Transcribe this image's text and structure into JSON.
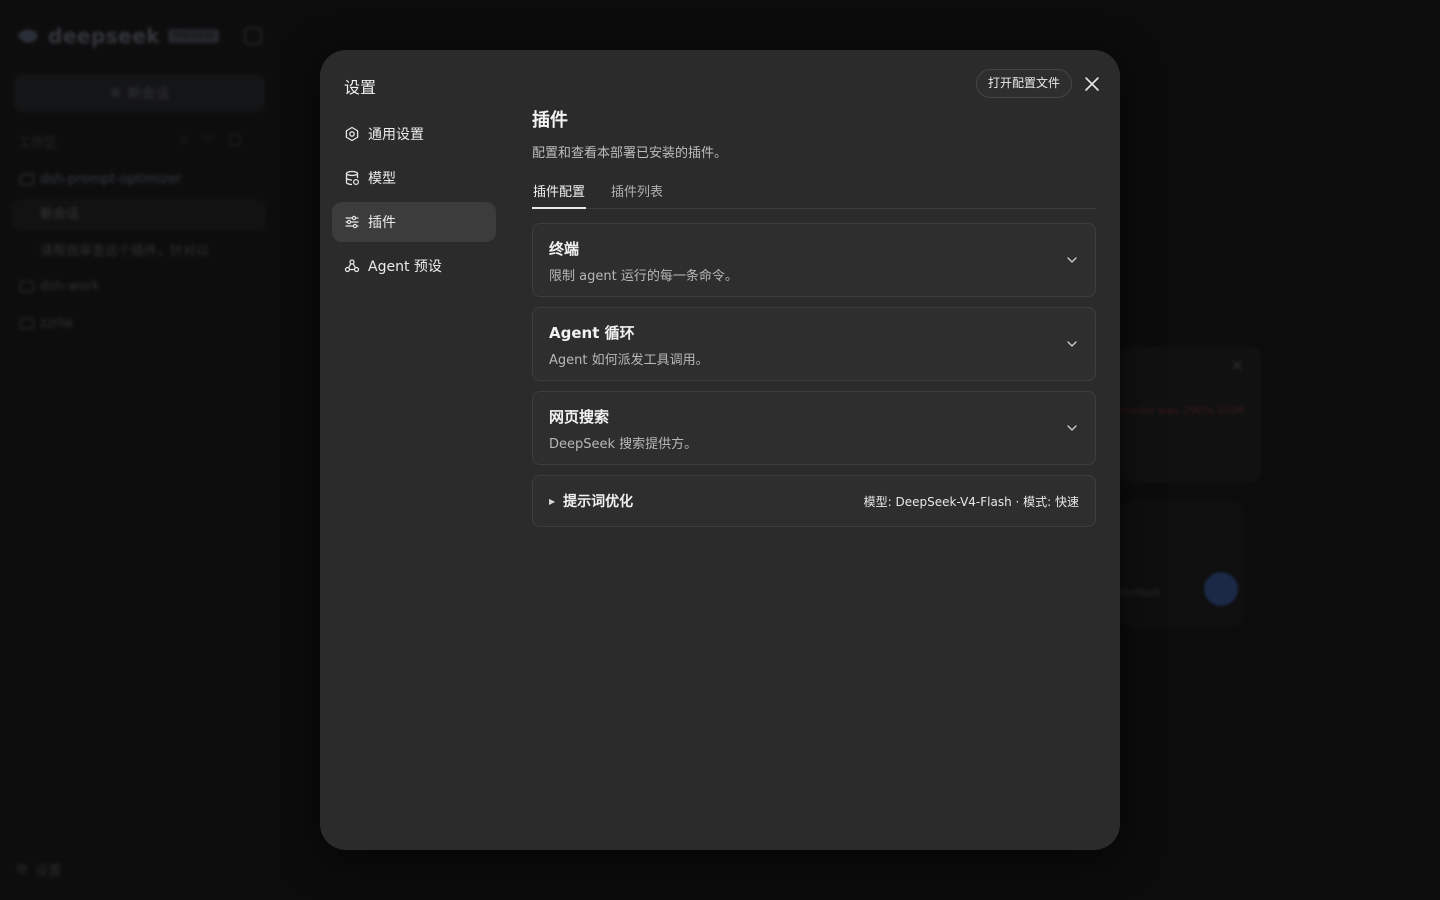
{
  "background": {
    "brand": {
      "name": "deepseek",
      "badge": "PREVIEW"
    },
    "new_chat_label": "新会话",
    "workspace_label": "工作区",
    "tree": [
      {
        "label": "dsh-prompt-optimizer",
        "kind": "folder"
      },
      {
        "label": "新会话",
        "kind": "chat",
        "selected": true
      },
      {
        "label": "请帮我审查这个插件，针对以",
        "kind": "chat",
        "meta": "2天"
      },
      {
        "label": "dsh-work",
        "kind": "folder"
      },
      {
        "label": "zzrlw",
        "kind": "folder"
      }
    ],
    "settings_label": "设置",
    "card_error_text": "model was 290% GGM 3.3",
    "model_select_label": "Default"
  },
  "modal": {
    "title": "设置",
    "open_config_label": "打开配置文件",
    "nav": [
      {
        "label": "通用设置",
        "icon": "gear-icon",
        "active": false
      },
      {
        "label": "模型",
        "icon": "database-icon",
        "active": false
      },
      {
        "label": "插件",
        "icon": "sliders-icon",
        "active": true
      },
      {
        "label": "Agent 预设",
        "icon": "agent-icon",
        "active": false
      }
    ],
    "content": {
      "title": "插件",
      "description": "配置和查看本部署已安装的插件。",
      "tabs": [
        {
          "label": "插件配置",
          "active": true
        },
        {
          "label": "插件列表",
          "active": false
        }
      ],
      "panels": [
        {
          "title": "终端",
          "subtitle": "限制 agent 运行的每一条命令。"
        },
        {
          "title": "Agent 循环",
          "subtitle": "Agent 如何派发工具调用。"
        },
        {
          "title": "网页搜索",
          "subtitle": "DeepSeek 搜索提供方。"
        }
      ],
      "prompt_opt": {
        "title": "提示词优化",
        "meta": "模型: DeepSeek-V4-Flash · 模式: 快速"
      }
    }
  }
}
